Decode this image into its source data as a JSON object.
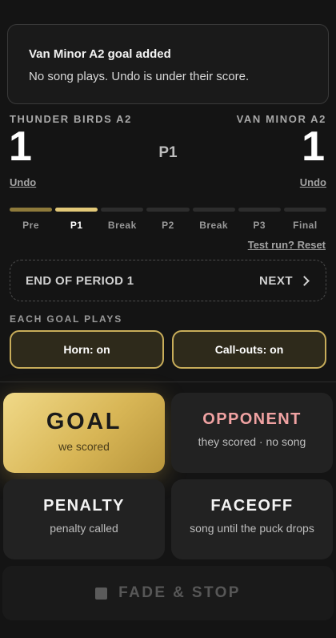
{
  "toast": {
    "title": "Van Minor A2 goal added",
    "body": "No song plays. Undo is under their score."
  },
  "scoreboard": {
    "home": {
      "name": "THUNDER BIRDS A2",
      "score": "1",
      "undo": "Undo"
    },
    "away": {
      "name": "VAN MINOR A2",
      "score": "1",
      "undo": "Undo"
    },
    "period": "P1"
  },
  "progress": {
    "phases": [
      "Pre",
      "P1",
      "Break",
      "P2",
      "Break",
      "P3",
      "Final"
    ],
    "current_index": 1
  },
  "test_link": "Test run? Reset",
  "next_box": {
    "label": "END OF PERIOD 1",
    "action": "NEXT"
  },
  "goal_plays": {
    "label": "EACH GOAL PLAYS",
    "horn": "Horn: on",
    "callouts": "Call-outs: on"
  },
  "actions": {
    "goal": {
      "label": "GOAL",
      "sub": "we scored"
    },
    "opponent": {
      "label": "OPPONENT",
      "sub": "they scored · no song"
    },
    "penalty": {
      "label": "PENALTY",
      "sub": "penalty called"
    },
    "faceoff": {
      "label": "FACEOFF",
      "sub": "song until the puck drops"
    }
  },
  "fade": {
    "label": "FADE & STOP"
  },
  "colors": {
    "accent_gold": "#d8b656",
    "opponent_pink": "#f0a2a2",
    "background": "#141414"
  }
}
